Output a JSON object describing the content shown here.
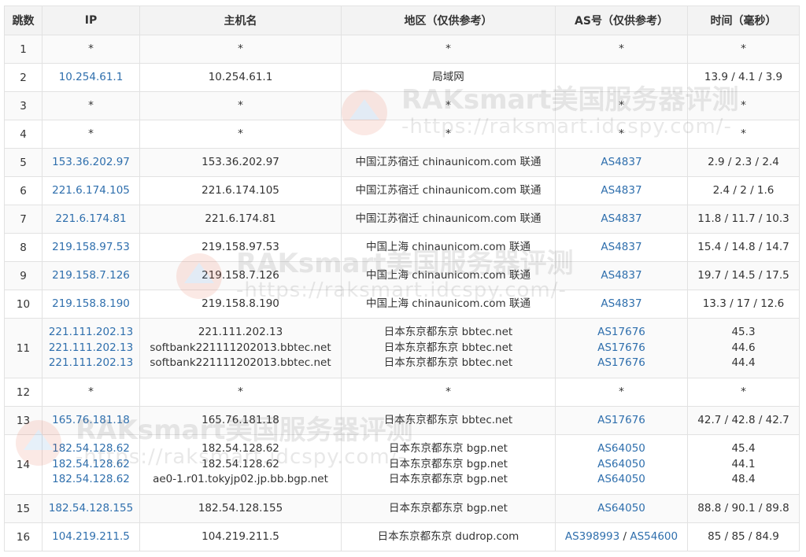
{
  "headers": [
    "跳数",
    "IP",
    "主机名",
    "地区（仅供参考）",
    "AS号（仅供参考）",
    "时间（毫秒）"
  ],
  "watermark": {
    "title": "RAKsmart美国服务器评测",
    "url": "-https://raksmart.idcspy.com/-"
  },
  "rows": [
    {
      "hop": "1",
      "ips": [
        "*"
      ],
      "hosts": [
        "*"
      ],
      "regions": [
        "*"
      ],
      "as": [
        [
          "*"
        ]
      ],
      "times": [
        "*"
      ]
    },
    {
      "hop": "2",
      "ips": [
        "10.254.61.1"
      ],
      "hosts": [
        "10.254.61.1"
      ],
      "regions": [
        "局域网"
      ],
      "as": [
        []
      ],
      "times": [
        "13.9 / 4.1 / 3.9"
      ]
    },
    {
      "hop": "3",
      "ips": [
        "*"
      ],
      "hosts": [
        "*"
      ],
      "regions": [
        "*"
      ],
      "as": [
        [
          "*"
        ]
      ],
      "times": [
        "*"
      ]
    },
    {
      "hop": "4",
      "ips": [
        "*"
      ],
      "hosts": [
        "*"
      ],
      "regions": [
        "*"
      ],
      "as": [
        [
          "*"
        ]
      ],
      "times": [
        "*"
      ]
    },
    {
      "hop": "5",
      "ips": [
        "153.36.202.97"
      ],
      "hosts": [
        "153.36.202.97"
      ],
      "regions": [
        "中国江苏宿迁 chinaunicom.com 联通"
      ],
      "as": [
        [
          "AS4837"
        ]
      ],
      "times": [
        "2.9 / 2.3 / 2.4"
      ]
    },
    {
      "hop": "6",
      "ips": [
        "221.6.174.105"
      ],
      "hosts": [
        "221.6.174.105"
      ],
      "regions": [
        "中国江苏宿迁 chinaunicom.com 联通"
      ],
      "as": [
        [
          "AS4837"
        ]
      ],
      "times": [
        "2.4 / 2 / 1.6"
      ]
    },
    {
      "hop": "7",
      "ips": [
        "221.6.174.81"
      ],
      "hosts": [
        "221.6.174.81"
      ],
      "regions": [
        "中国江苏宿迁 chinaunicom.com 联通"
      ],
      "as": [
        [
          "AS4837"
        ]
      ],
      "times": [
        "11.8 / 11.7 / 10.3"
      ]
    },
    {
      "hop": "8",
      "ips": [
        "219.158.97.53"
      ],
      "hosts": [
        "219.158.97.53"
      ],
      "regions": [
        "中国上海 chinaunicom.com 联通"
      ],
      "as": [
        [
          "AS4837"
        ]
      ],
      "times": [
        "15.4 / 14.8 / 14.7"
      ]
    },
    {
      "hop": "9",
      "ips": [
        "219.158.7.126"
      ],
      "hosts": [
        "219.158.7.126"
      ],
      "regions": [
        "中国上海 chinaunicom.com 联通"
      ],
      "as": [
        [
          "AS4837"
        ]
      ],
      "times": [
        "19.7 / 14.5 / 17.5"
      ]
    },
    {
      "hop": "10",
      "ips": [
        "219.158.8.190"
      ],
      "hosts": [
        "219.158.8.190"
      ],
      "regions": [
        "中国上海 chinaunicom.com 联通"
      ],
      "as": [
        [
          "AS4837"
        ]
      ],
      "times": [
        "13.3 / 17 / 12.6"
      ]
    },
    {
      "hop": "11",
      "ips": [
        "221.111.202.13",
        "221.111.202.13",
        "221.111.202.13"
      ],
      "hosts": [
        "221.111.202.13",
        "softbank221111202013.bbtec.net",
        "softbank221111202013.bbtec.net"
      ],
      "regions": [
        "日本东京都东京 bbtec.net",
        "日本东京都东京 bbtec.net",
        "日本东京都东京 bbtec.net"
      ],
      "as": [
        [
          "AS17676"
        ],
        [
          "AS17676"
        ],
        [
          "AS17676"
        ]
      ],
      "times": [
        "45.3",
        "44.6",
        "44.4"
      ]
    },
    {
      "hop": "12",
      "ips": [
        "*"
      ],
      "hosts": [
        "*"
      ],
      "regions": [
        "*"
      ],
      "as": [
        [
          "*"
        ]
      ],
      "times": [
        "*"
      ]
    },
    {
      "hop": "13",
      "ips": [
        "165.76.181.18"
      ],
      "hosts": [
        "165.76.181.18"
      ],
      "regions": [
        "日本东京都东京 bbtec.net"
      ],
      "as": [
        [
          "AS17676"
        ]
      ],
      "times": [
        "42.7 / 42.8 / 42.7"
      ]
    },
    {
      "hop": "14",
      "ips": [
        "182.54.128.62",
        "182.54.128.62",
        "182.54.128.62"
      ],
      "hosts": [
        "182.54.128.62",
        "182.54.128.62",
        "ae0-1.r01.tokyjp02.jp.bb.bgp.net"
      ],
      "regions": [
        "日本东京都东京 bgp.net",
        "日本东京都东京 bgp.net",
        "日本东京都东京 bgp.net"
      ],
      "as": [
        [
          "AS64050"
        ],
        [
          "AS64050"
        ],
        [
          "AS64050"
        ]
      ],
      "times": [
        "45.4",
        "44.1",
        "48.4"
      ]
    },
    {
      "hop": "15",
      "ips": [
        "182.54.128.155"
      ],
      "hosts": [
        "182.54.128.155"
      ],
      "regions": [
        "日本东京都东京 bgp.net"
      ],
      "as": [
        [
          "AS64050"
        ]
      ],
      "times": [
        "88.8 / 90.1 / 89.8"
      ]
    },
    {
      "hop": "16",
      "ips": [
        "104.219.211.5"
      ],
      "hosts": [
        "104.219.211.5"
      ],
      "regions": [
        "日本东京都东京 dudrop.com"
      ],
      "as": [
        [
          "AS398993",
          "AS54600"
        ]
      ],
      "times": [
        "85 / 85 / 84.9"
      ]
    }
  ]
}
